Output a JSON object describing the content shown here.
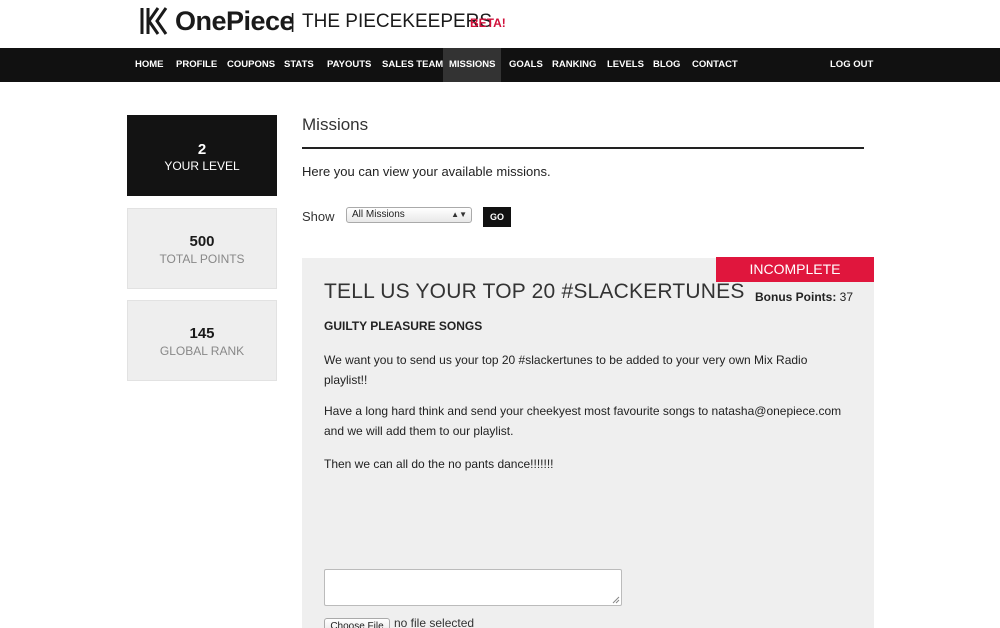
{
  "brand": {
    "name": "OnePiece",
    "separator": "|",
    "subtitle": "THE PIECEKEEPERS",
    "badge": "BETA!",
    "accent_color": "#d0103a"
  },
  "nav": {
    "items": [
      {
        "label": "HOME"
      },
      {
        "label": "PROFILE"
      },
      {
        "label": "COUPONS"
      },
      {
        "label": "STATS"
      },
      {
        "label": "PAYOUTS"
      },
      {
        "label": "SALES TEAM"
      },
      {
        "label": "MISSIONS",
        "active": true
      },
      {
        "label": "GOALS"
      },
      {
        "label": "RANKING"
      },
      {
        "label": "LEVELS"
      },
      {
        "label": "BLOG"
      },
      {
        "label": "CONTACT"
      }
    ],
    "logout": "LOG OUT"
  },
  "sidebar": {
    "level": {
      "value": "2",
      "label": "YOUR LEVEL"
    },
    "points": {
      "value": "500",
      "label": "TOTAL POINTS"
    },
    "rank": {
      "value": "145",
      "label": "GLOBAL RANK"
    }
  },
  "main": {
    "title": "Missions",
    "intro": "Here you can view your available missions.",
    "filter": {
      "label": "Show",
      "selected": "All Missions",
      "button": "GO"
    }
  },
  "mission": {
    "status": "INCOMPLETE",
    "status_color": "#e0163d",
    "bonus_label": "Bonus Points:",
    "bonus_value": "37",
    "title": "TELL US YOUR TOP 20 #SLACKERTUNES",
    "subtitle": "GUILTY PLEASURE SONGS",
    "paragraphs": [
      "We want you to send us your top 20 #slackertunes to be added to your very own Mix Radio playlist!!",
      "Have a long hard think and send your cheekyest most favourite songs to natasha@onepiece.com and we will add them to our playlist.",
      "Then we can all do the no pants dance!!!!!!!"
    ],
    "answer_value": "",
    "file_button": "Choose File",
    "file_status": "no file selected"
  },
  "icons": {
    "logo": "onepiece-logo-icon",
    "select_arrow": "chevron-updown-icon",
    "resize": "resize-handle-icon"
  }
}
